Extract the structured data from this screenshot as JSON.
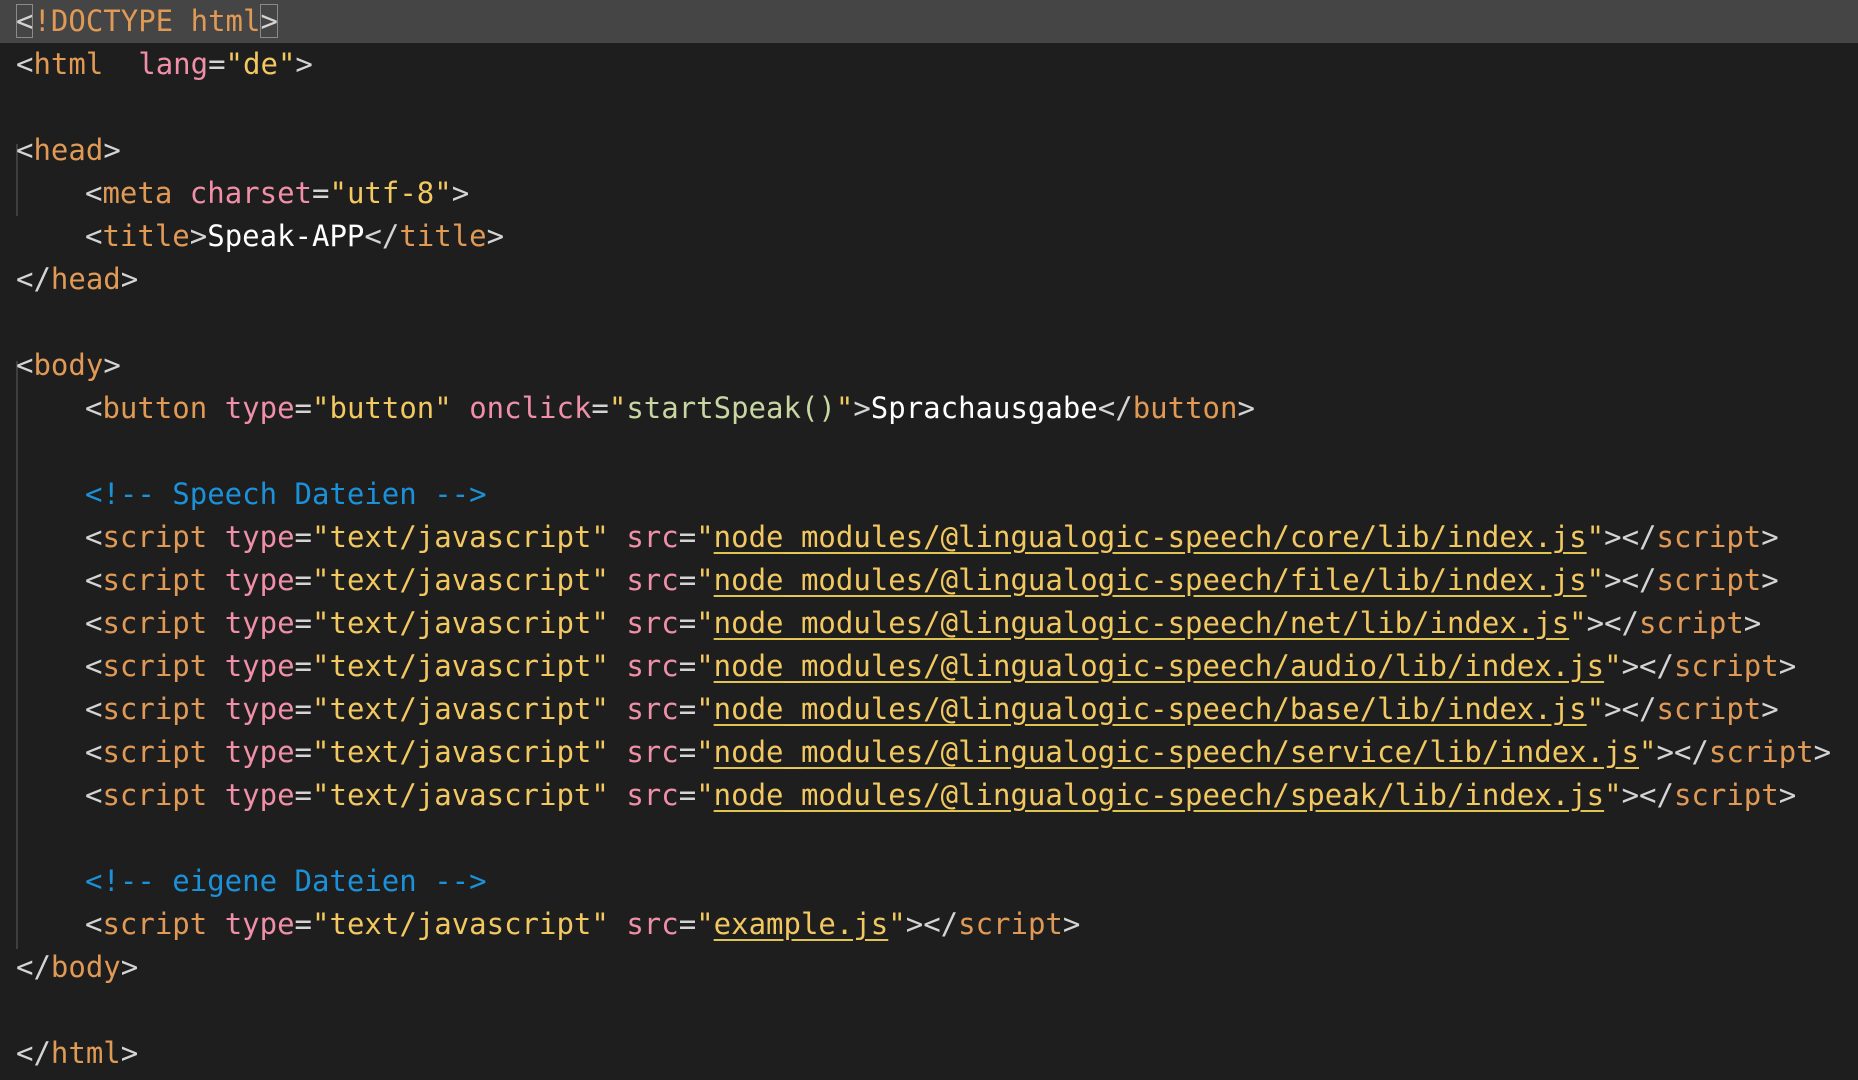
{
  "editor": {
    "doctype": {
      "bracket_open": "<",
      "keyword": "!DOCTYPE html",
      "bracket_close": ">"
    },
    "html_open": {
      "tag": "html",
      "attr": "lang",
      "value": "de"
    },
    "head_open": {
      "tag": "head"
    },
    "meta": {
      "tag": "meta",
      "attr": "charset",
      "value": "utf-8"
    },
    "title": {
      "tag": "title",
      "text": "Speak-APP"
    },
    "head_close": {
      "tag": "head"
    },
    "body_open": {
      "tag": "body"
    },
    "button": {
      "tag": "button",
      "attr_type": "type",
      "value_type": "button",
      "attr_onclick": "onclick",
      "value_onclick": "startSpeak()",
      "text": "Sprachausgabe"
    },
    "comment_speech": "<!-- Speech Dateien -->",
    "scripts": [
      {
        "tag": "script",
        "attr_type": "type",
        "value_type": "text/javascript",
        "attr_src": "src",
        "src": "node_modules/@lingualogic-speech/core/lib/index.js"
      },
      {
        "tag": "script",
        "attr_type": "type",
        "value_type": "text/javascript",
        "attr_src": "src",
        "src": "node_modules/@lingualogic-speech/file/lib/index.js"
      },
      {
        "tag": "script",
        "attr_type": "type",
        "value_type": "text/javascript",
        "attr_src": "src",
        "src": "node_modules/@lingualogic-speech/net/lib/index.js"
      },
      {
        "tag": "script",
        "attr_type": "type",
        "value_type": "text/javascript",
        "attr_src": "src",
        "src": "node_modules/@lingualogic-speech/audio/lib/index.js"
      },
      {
        "tag": "script",
        "attr_type": "type",
        "value_type": "text/javascript",
        "attr_src": "src",
        "src": "node_modules/@lingualogic-speech/base/lib/index.js"
      },
      {
        "tag": "script",
        "attr_type": "type",
        "value_type": "text/javascript",
        "attr_src": "src",
        "src": "node_modules/@lingualogic-speech/service/lib/index.js"
      },
      {
        "tag": "script",
        "attr_type": "type",
        "value_type": "text/javascript",
        "attr_src": "src",
        "src": "node_modules/@lingualogic-speech/speak/lib/index.js"
      }
    ],
    "comment_own": "<!-- eigene Dateien -->",
    "own_script": {
      "tag": "script",
      "attr_type": "type",
      "value_type": "text/javascript",
      "attr_src": "src",
      "src": "example.js"
    },
    "body_close": {
      "tag": "body"
    },
    "html_close": {
      "tag": "html"
    }
  },
  "colors": {
    "background": "#1e1e1e",
    "current_line": "#454545",
    "tag": "#e09a55",
    "attribute": "#f08fa8",
    "string": "#f2c860",
    "function": "#c8d7a1",
    "comment": "#1a91d8",
    "text": "#ffffff"
  }
}
